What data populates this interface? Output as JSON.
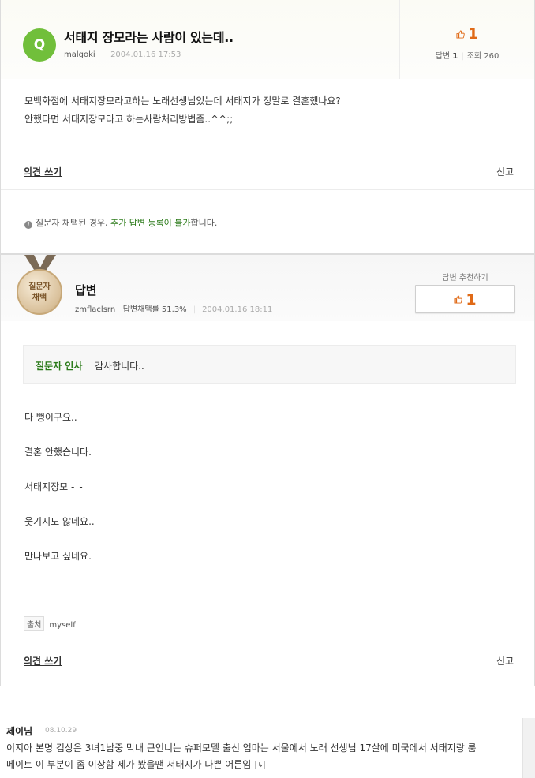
{
  "question": {
    "badge": "Q",
    "title": "서태지 장모라는 사람이 있는데..",
    "author": "malgoki",
    "date": "2004.01.16 17:53",
    "likes": "1",
    "answers_label": "답변",
    "answers_count": "1",
    "views_label": "조회",
    "views_count": "260",
    "body_lines": [
      "모백화점에 서태지장모라고하는 노래선생님있는데 서태지가 정말로 결혼했나요?",
      "안했다면 서태지장모라고 하는사람처리방법좀..^^;;"
    ],
    "write_opinion": "의견 쓰기",
    "report": "신고",
    "notice_prefix": "질문자 채택된 경우, ",
    "notice_highlight": "추가 답변 등록이 불가",
    "notice_suffix": "합니다."
  },
  "answer": {
    "medal_line1": "질문자",
    "medal_line2": "채택",
    "title": "답변",
    "author": "zmflaclsrn",
    "adopt_rate": "답변채택률 51.3%",
    "date": "2004.01.16 18:11",
    "recommend_label": "답변 추천하기",
    "recommend_count": "1",
    "greeting_label": "질문자 인사",
    "greeting_text": "감사합니다..",
    "body_lines": [
      "다 뻥이구요..",
      "결혼 안했습니다.",
      "서태지장모 -_-",
      "웃기지도 않네요..",
      "만나보고 싶네요."
    ],
    "source_tag": "출처",
    "source_value": "myself",
    "write_opinion": "의견 쓰기",
    "report": "신고"
  },
  "comment": {
    "user": "제이님",
    "date": "08.10.29",
    "line1": "이지아 본명 김상은 3녀1남중 막내 큰언니는 슈퍼모델 출신 엄마는 서울에서 노래 선생님 17살에 미국에서 서태지랑 룸",
    "line2": "메이트 이 부분이 좀 이상함 제가 봤을땐 서태지가 나쁜 어른임",
    "more_icon": "↳"
  },
  "colors": {
    "green": "#71bf3b",
    "orange": "#e06a17",
    "link_green": "#2a7a18"
  }
}
